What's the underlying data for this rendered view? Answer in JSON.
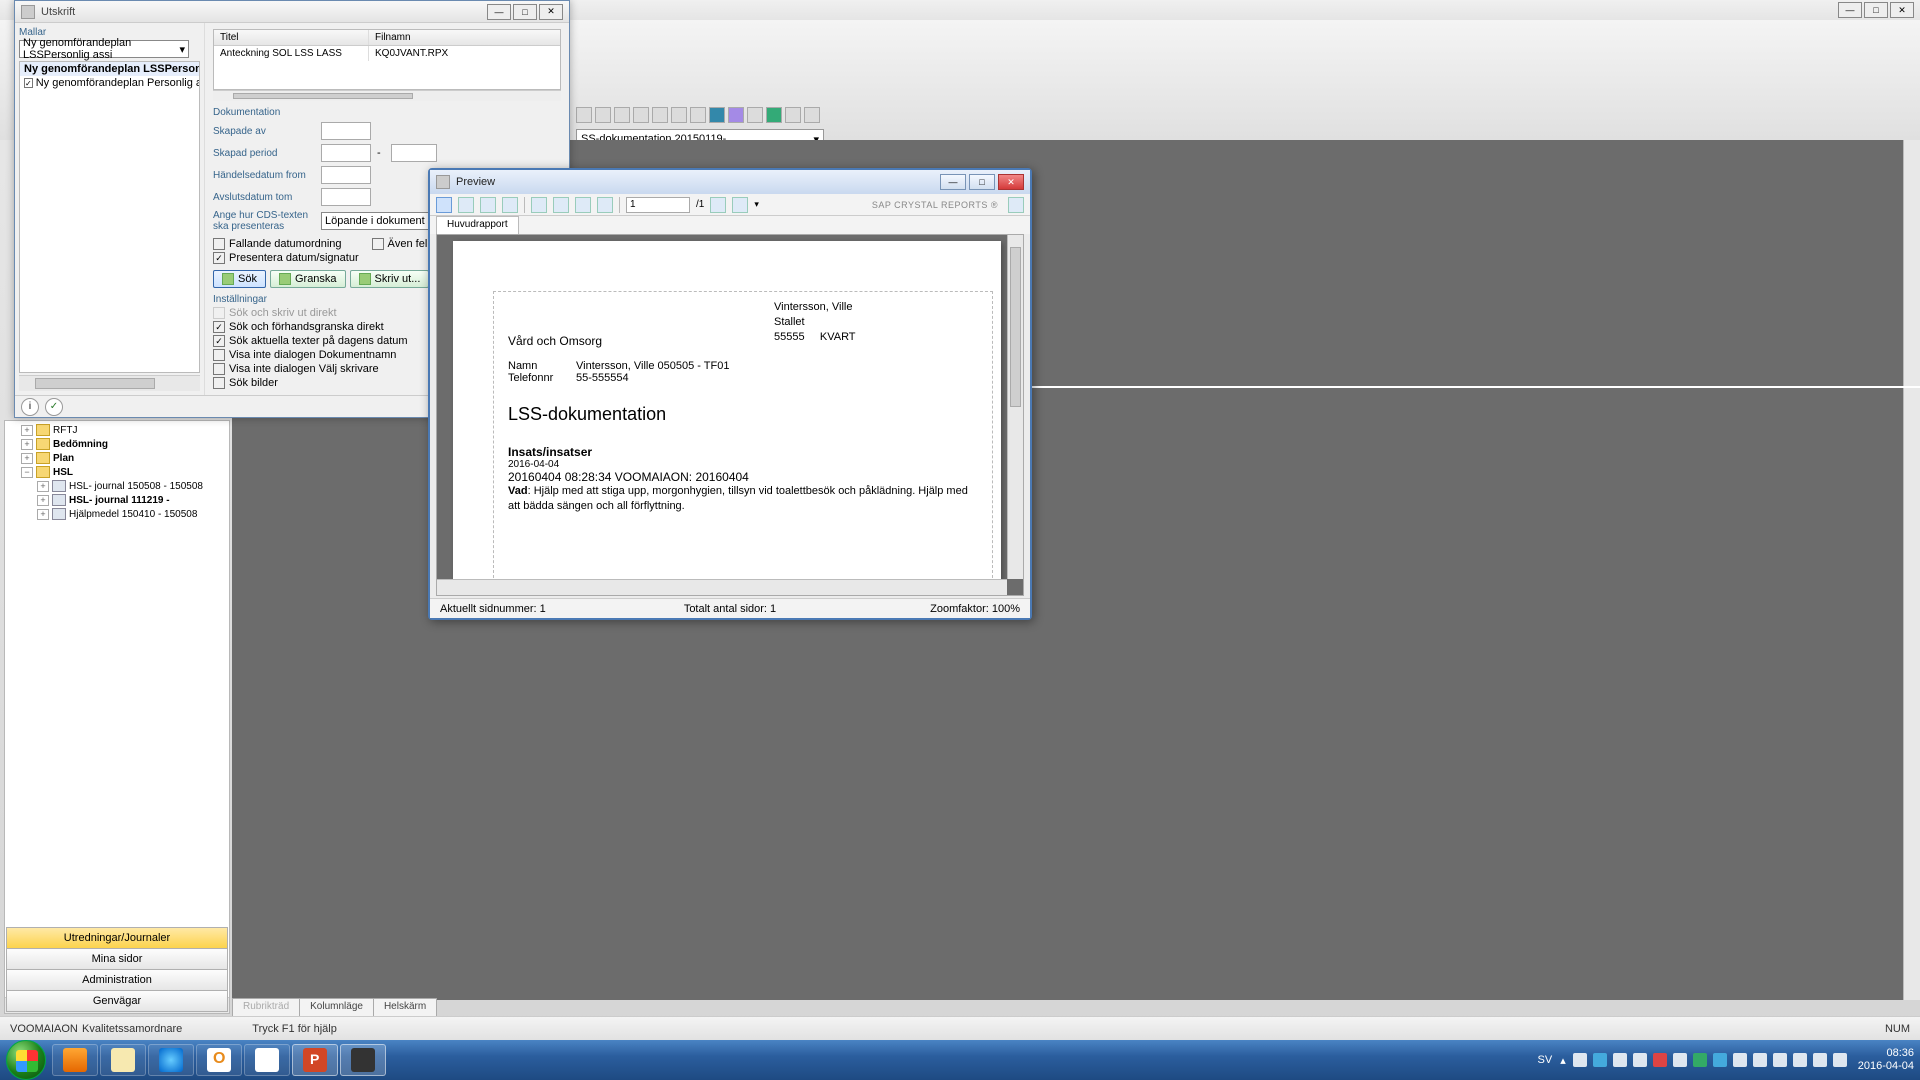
{
  "main_window": {
    "dropdown": "SS-dokumentation 20150119-"
  },
  "bottom_tabs": {
    "t1": "Rubrikträd",
    "t2": "Kolumnläge",
    "t3": "Helskärm"
  },
  "status": {
    "user": "VOOMAIAON",
    "role": "Kvalitetssamordnare",
    "hint": "Tryck F1 för hjälp",
    "num": "NUM"
  },
  "tree": {
    "n0": "RFTJ",
    "n1": "Bedömning",
    "n2": "Plan",
    "n3": "HSL",
    "n4": "HSL- journal 150508 - 150508",
    "n5": "HSL- journal  111219 -",
    "n6": "Hjälpmedel 150410 - 150508"
  },
  "accordion": {
    "a1": "Utredningar/Journaler",
    "a2": "Mina sidor",
    "a3": "Administration",
    "a4": "Genvägar"
  },
  "utskrift": {
    "title": "Utskrift",
    "mallar_label": "Mallar",
    "combo": "Ny genomförandeplan LSSPersonlig assi",
    "list_item1": "Ny genomförandeplan LSSPersonlig a",
    "list_item2": "Ny genomförandeplan Personlig a",
    "th_titel": "Titel",
    "th_filnamn": "Filnamn",
    "td_titel": "Anteckning SOL LSS LASS",
    "td_filnamn": "KQ0JVANT.RPX",
    "dokumentation": "Dokumentation",
    "skapad_av": "Skapade av",
    "skapad_period": "Skapad period",
    "handelse": "Händelsedatum from",
    "avslut": "Avslutsdatum tom",
    "ange": "Ange hur CDS-texten ska presenteras",
    "ange_val": "Löpande i dokument",
    "chk_fallande": "Fallande datumordning",
    "chk_aven": "Även felmarke",
    "chk_present": "Presentera datum/signatur",
    "btn_sok": "Sök",
    "btn_granska": "Granska",
    "btn_skriv": "Skriv ut...",
    "btn_sk": "Sk",
    "installningar": "Inställningar",
    "chk_i1": "Sök och skriv ut direkt",
    "chk_i2": "Sök och förhandsgranska direkt",
    "chk_i3": "Sök aktuella texter på dagens datum",
    "chk_i4": "Visa inte dialogen Dokumentnamn",
    "chk_i5": "Visa inte dialogen Välj skrivare",
    "chk_i6": "Sök bilder"
  },
  "preview": {
    "title": "Preview",
    "tab": "Huvudrapport",
    "page": "1",
    "page_of": "/1",
    "brand": "SAP CRYSTAL REPORTS ®",
    "status_current": "Aktuellt sidnummer: 1",
    "status_total": "Totalt antal sidor: 1",
    "status_zoom": "Zoomfaktor: 100%",
    "report": {
      "hdr_name": "Vintersson, Ville",
      "hdr_addr": "Stallet",
      "hdr_post": "55555     KVART",
      "dept": "Vård och Omsorg",
      "lab_namn": "Namn",
      "val_namn": "Vintersson, Ville  050505 - TF01",
      "lab_tel": "Telefonnr",
      "val_tel": "55-555554",
      "h2": "LSS-dokumentation",
      "h4": "Insats/insatser",
      "date": "2016-04-04",
      "sig": " 20160404 08:28:34 VOOMAIAON: 20160404",
      "vad_label": "Vad",
      "vad_text": ": Hjälp med att stiga upp, morgonhygien, tillsyn vid toalettbesök och påklädning. Hjälp med att bädda sängen och all förflyttning."
    }
  },
  "taskbar": {
    "lang": "SV",
    "time": "08:36",
    "date": "2016-04-04"
  }
}
